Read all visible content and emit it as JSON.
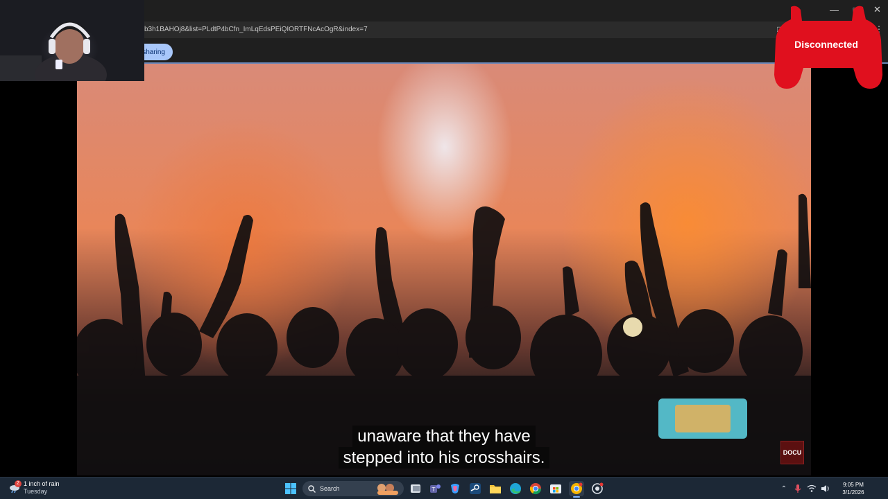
{
  "browser": {
    "url": "b3h1BAHOj8&list=PLdtP4bCfn_ImLqEdsPEiQIORTFNcAcOgR&index=7",
    "sharing_label": "sharing"
  },
  "video": {
    "subtitle_line1": "unaware that they have",
    "subtitle_line2": "stepped into his crosshairs.",
    "watermark": "DOCU"
  },
  "overlay": {
    "status": "Disconnected",
    "color": "#e0101e"
  },
  "taskbar": {
    "weather_title": "1 inch of rain",
    "weather_subtitle": "Tuesday",
    "weather_badge": "2",
    "search_label": "Search",
    "time": "9:05 PM",
    "date": "3/1/2026",
    "pinned_apps": [
      "start-icon",
      "task-view-icon",
      "teams-icon",
      "copilot-icon",
      "steam-icon",
      "file-explorer-icon",
      "edge-icon",
      "chrome-icon",
      "store-icon",
      "chrome-canary-icon",
      "chrome-dev-icon"
    ]
  }
}
